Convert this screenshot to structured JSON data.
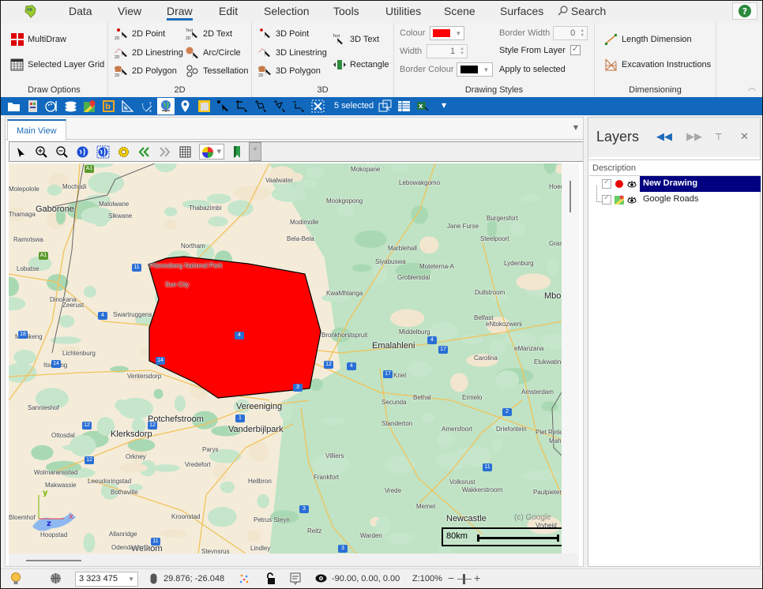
{
  "app": {
    "menu": [
      {
        "label": "Data",
        "active": false
      },
      {
        "label": "View",
        "active": false
      },
      {
        "label": "Draw",
        "active": true
      },
      {
        "label": "Edit",
        "active": false
      },
      {
        "label": "Selection",
        "active": false
      },
      {
        "label": "Tools",
        "active": false
      },
      {
        "label": "Utilities",
        "active": false
      },
      {
        "label": "Scene",
        "active": false
      },
      {
        "label": "Surfaces",
        "active": false
      }
    ],
    "search_label": "Search",
    "help_label": "?"
  },
  "ribbon": {
    "draw_options": {
      "title": "Draw Options",
      "items": [
        "MultiDraw",
        "Selected Layer Grid"
      ]
    },
    "group_2d": {
      "title": "2D",
      "items": [
        "2D Point",
        "2D Linestring",
        "2D Polygon",
        "2D Text",
        "Arc/Circle",
        "Tessellation"
      ]
    },
    "group_3d": {
      "title": "3D",
      "items": [
        "3D Point",
        "3D Linestring",
        "3D Polygon",
        "3D Text",
        "Rectangle"
      ]
    },
    "drawing_styles": {
      "title": "Drawing Styles",
      "colour_label": "Colour",
      "colour_value": "#ff0000",
      "width_label": "Width",
      "width_value": "1",
      "border_colour_label": "Border Colour",
      "border_colour_value": "#000000",
      "border_width_label": "Border Width",
      "border_width_value": "0",
      "style_from_layer_label": "Style From Layer",
      "style_from_layer_checked": true,
      "apply_label": "Apply to selected"
    },
    "dimensioning": {
      "title": "Dimensioning",
      "items": [
        "Length Dimension",
        "Excavation Instructions"
      ]
    }
  },
  "toolbar": {
    "selected_count_label": "5 selected"
  },
  "main_view": {
    "tab_label": "Main View",
    "map": {
      "scale_label": "80km",
      "copyright": "(c) Google",
      "axis": {
        "x": "x",
        "y": "y",
        "z": "z"
      },
      "polygon_fill": "#ff0000",
      "labels_big": [
        "Gaborone",
        "Emalahleni",
        "Vereeniging",
        "Vanderbijlpark",
        "Potchefstroom",
        "Klerksdorp",
        "Newcastle",
        "Welkom",
        "Mbo"
      ],
      "labels": [
        "Molepolole",
        "Mochudi",
        "Malolwane",
        "Sikwane",
        "Thamaga",
        "Ramotswa",
        "Lobatse",
        "Thabazimbi",
        "Northam",
        "Pilanesberg National Park",
        "Sun City",
        "Dinokana",
        "Zeerust",
        "Swartruggens",
        "Mahikeng",
        "Lichtenburg",
        "Itsoseng",
        "Ventersdorp",
        "Sannieshof",
        "Ottosdal",
        "Orkney",
        "Wolmaransstad",
        "Makwassie",
        "Leeudoringstad",
        "Bothaville",
        "Bloemhof",
        "Hoopstad",
        "Allanridge",
        "Odendaalsrus",
        "Kroonstad",
        "Parys",
        "Vredefort",
        "Heilbron",
        "Steynsrus",
        "Lindley",
        "Petrus Steyn",
        "Mokopane",
        "Lebowakgomo",
        "Vaalwater",
        "Mookgopong",
        "Modimolle",
        "Bela-Bela",
        "Marblehall",
        "Siyabuswa",
        "Moteterna-A",
        "Groblersdal",
        "KwaMhlanga",
        "Bronkhorstspruit",
        "Middelburg",
        "Jane Furse",
        "Burgersfort",
        "Steelpoort",
        "Lydenburg",
        "Dullstroom",
        "Belfast",
        "eNtokozweni",
        "eManzana",
        "Carolina",
        "Elukwatini",
        "Kriel",
        "Bethal",
        "Secunda",
        "Ermelo",
        "Amsterdam",
        "Standerton",
        "Amersfoort",
        "Driefontein",
        "Piet Retief",
        "Villiers",
        "Frankfort",
        "Vrede",
        "Volksrust",
        "Wakkerstroom",
        "Memel",
        "Reitz",
        "Warden",
        "Vryheid",
        "Paulpietersburg",
        "Hoedspruit",
        "Graskop",
        "Mahamba"
      ],
      "shields": [
        "A1",
        "A1",
        "4",
        "18",
        "11",
        "4",
        "4",
        "11",
        "4",
        "12",
        "14",
        "14",
        "12",
        "12",
        "1",
        "3",
        "3",
        "17",
        "17",
        "2",
        "11",
        "3",
        "12"
      ]
    }
  },
  "layers": {
    "title": "Layers",
    "column": "Description",
    "rows": [
      {
        "name": "New Drawing",
        "selected": true,
        "checked": true,
        "visible": true,
        "icon": "red-dot"
      },
      {
        "name": "Google Roads",
        "selected": false,
        "checked": true,
        "visible": true,
        "icon": "google-maps"
      }
    ]
  },
  "status": {
    "scale_value": "3 323 475",
    "coordinates": "29.876; -26.048",
    "rotation": "-90.00, 0.00, 0.00",
    "zoom": "Z:100%"
  }
}
